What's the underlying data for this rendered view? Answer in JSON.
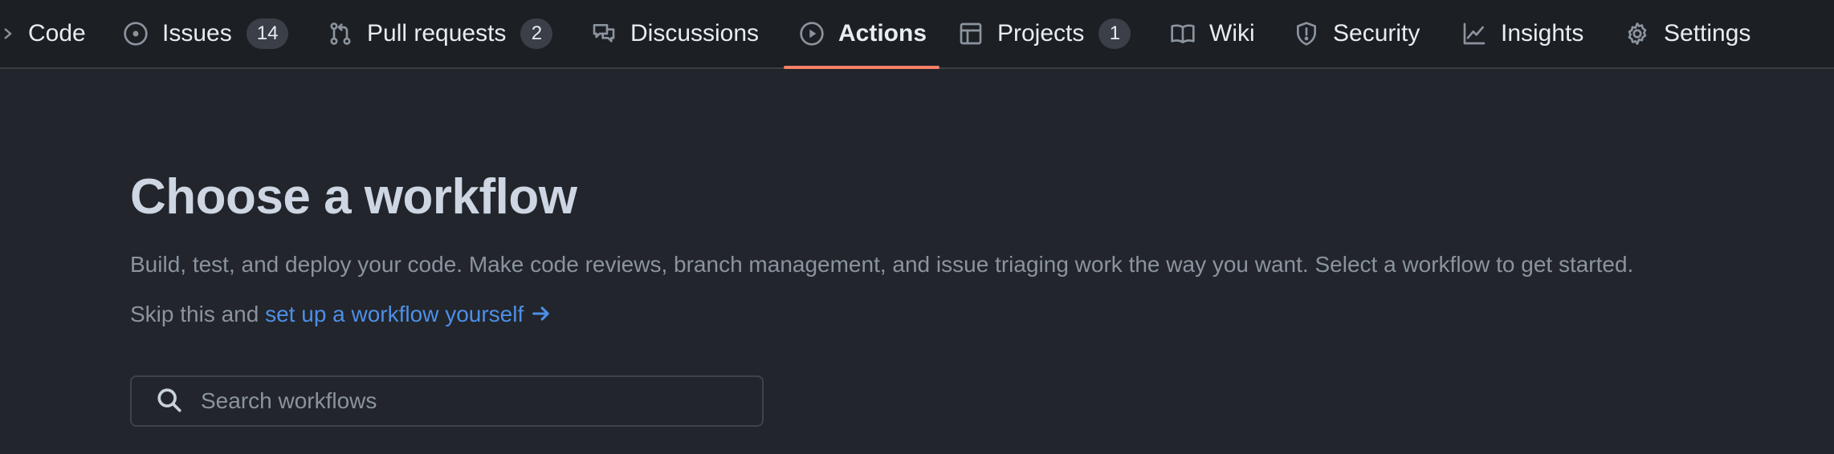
{
  "nav": {
    "overflow_icon": "chevron-right-icon",
    "tabs": [
      {
        "label": "Code",
        "icon": "code-icon"
      },
      {
        "label": "Issues",
        "icon": "issue-opened-icon",
        "count": "14"
      },
      {
        "label": "Pull requests",
        "icon": "git-pull-request-icon",
        "count": "2"
      },
      {
        "label": "Discussions",
        "icon": "comment-discussion-icon"
      },
      {
        "label": "Actions",
        "icon": "play-icon",
        "active": true
      },
      {
        "label": "Projects",
        "icon": "table-icon",
        "count": "1"
      },
      {
        "label": "Wiki",
        "icon": "book-icon"
      },
      {
        "label": "Security",
        "icon": "shield-icon"
      },
      {
        "label": "Insights",
        "icon": "graph-icon"
      },
      {
        "label": "Settings",
        "icon": "gear-icon"
      }
    ],
    "active_underline_color": "#f78166"
  },
  "main": {
    "title": "Choose a workflow",
    "description": "Build, test, and deploy your code. Make code reviews, branch management, and issue triaging work the way you want. Select a workflow to get started.",
    "skip_prefix": "Skip this and ",
    "skip_link": "set up a workflow yourself",
    "search": {
      "placeholder": "Search workflows",
      "value": ""
    }
  },
  "colors": {
    "background": "#22252b",
    "header_background": "#1c1f24",
    "link": "#4d8fe8",
    "muted_text": "#8b949e",
    "title_text": "#cdd6e2"
  }
}
